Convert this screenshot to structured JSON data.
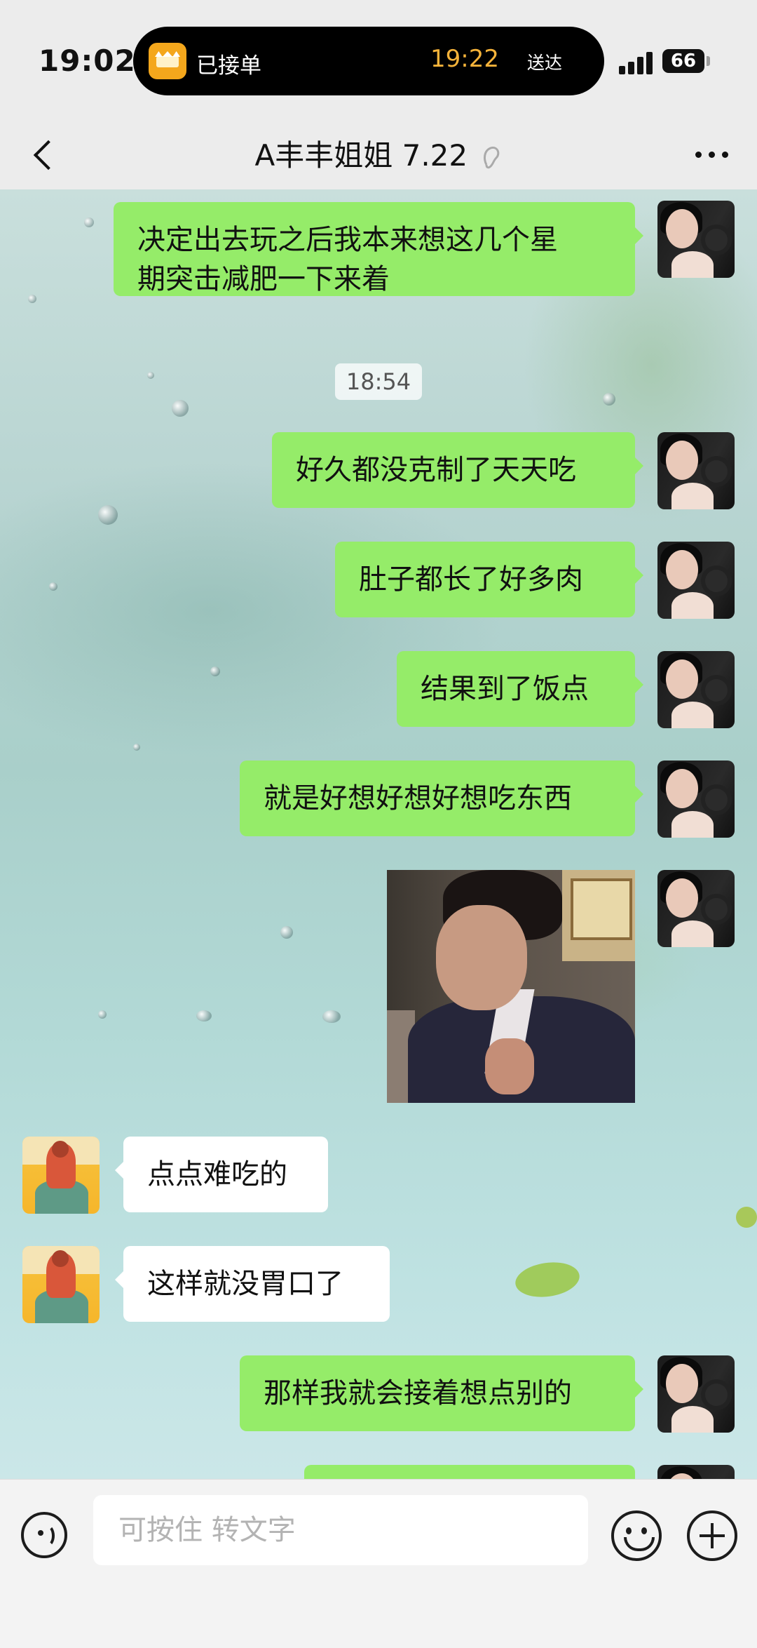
{
  "status_bar": {
    "time": "19:02",
    "order_status": "已接单",
    "eta_time": "19:22",
    "eta_label": "送达",
    "battery": "66"
  },
  "header": {
    "title": "A丰丰姐姐 7.22"
  },
  "messages": {
    "m1_line1": "决定出去玩之后我本来想这几个星",
    "m1_line2": "期突击减肥一下来着",
    "timestamp": "18:54",
    "m2": "好久都没克制了天天吃",
    "m3": "肚子都长了好多肉",
    "m4": "结果到了饭点",
    "m5": "就是好想好想好想吃东西",
    "m7": "点点难吃的",
    "m8": "这样就没胃口了",
    "m9": "那样我就会接着想点别的"
  },
  "input_bar": {
    "placeholder": "可按住 转文字"
  },
  "colors": {
    "my_bubble": "#95ec69",
    "other_bubble": "#ffffff",
    "eta_accent": "#f6b33a"
  },
  "icons": [
    "back-arrow-icon",
    "ear-icon",
    "more-icon",
    "voice-icon",
    "emoji-icon",
    "plus-icon",
    "delivery-app-icon",
    "signal-icon",
    "battery-icon"
  ]
}
